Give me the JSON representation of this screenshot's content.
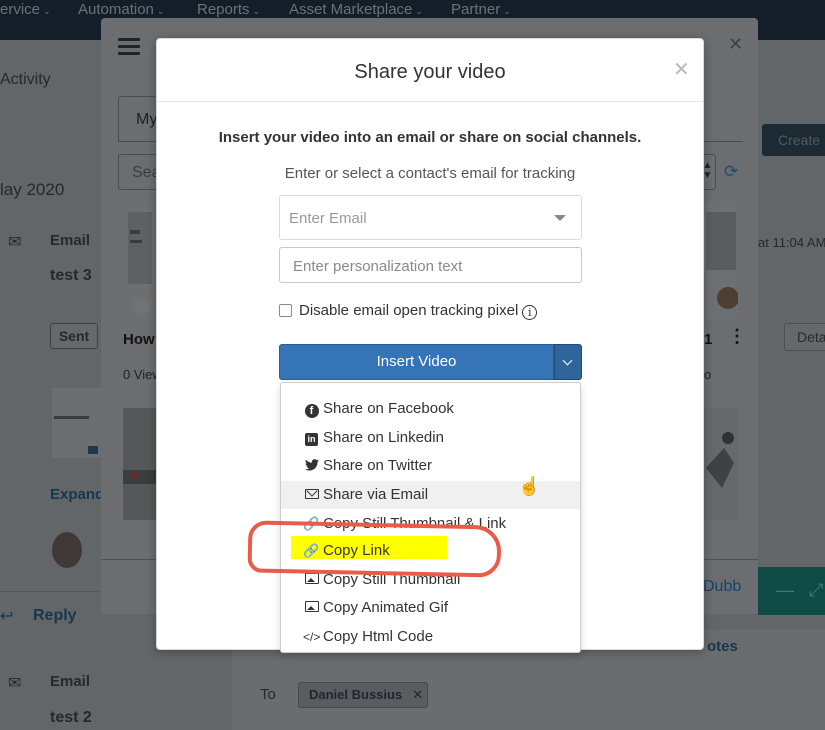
{
  "topnav": {
    "items": [
      {
        "label": "ervice"
      },
      {
        "label": "Automation"
      },
      {
        "label": "Reports"
      },
      {
        "label": "Asset Marketplace"
      },
      {
        "label": "Partner"
      }
    ]
  },
  "background": {
    "activity_label": "Activity",
    "month_label": "lay 2020",
    "email_type_1": "Email",
    "email_subject_1": "test 3",
    "sent_badge": "Sent",
    "time_stamp": "at 11:04 AM",
    "details_button": "Deta",
    "expand_link": "Expand",
    "reply_link": "Reply",
    "email_type_2": "Email",
    "email_subject_2": "test 2",
    "to_label": "To",
    "recipient_chip": "Daniel Bussius",
    "create_button": "Create",
    "notes_tab": "otes"
  },
  "outer_modal": {
    "tab_label": "My",
    "search_placeholder": "Sea",
    "video_title_1": "How",
    "video_title_2": "1",
    "views_1": "0 View",
    "views_2": "o",
    "dubb_label": "Dubb"
  },
  "share_modal": {
    "title": "Share your video",
    "intro": "Insert your video into an email or share on social channels.",
    "hint": "Enter or select a contact's email for tracking",
    "email_placeholder": "Enter Email",
    "personalization_placeholder": "Enter personalization text",
    "disable_tracking_label": "Disable email open tracking pixel",
    "insert_button": "Insert Video",
    "menu": [
      {
        "label": "Share on Facebook",
        "icon": "facebook-icon"
      },
      {
        "label": "Share on Linkedin",
        "icon": "linkedin-icon"
      },
      {
        "label": "Share on Twitter",
        "icon": "twitter-icon"
      },
      {
        "label": "Share via Email",
        "icon": "envelope-icon"
      },
      {
        "label": "Copy Still Thumbnail & Link",
        "icon": "link-icon"
      },
      {
        "label": "Copy Link",
        "icon": "link-icon"
      },
      {
        "label": "Copy Still Thumbnail",
        "icon": "image-icon"
      },
      {
        "label": "Copy Animated Gif",
        "icon": "image-icon"
      },
      {
        "label": "Copy Html Code",
        "icon": "code-icon"
      }
    ]
  },
  "colors": {
    "primary_button": "#3574b6",
    "highlight": "#ffff00",
    "annotation": "#e85d4a"
  }
}
